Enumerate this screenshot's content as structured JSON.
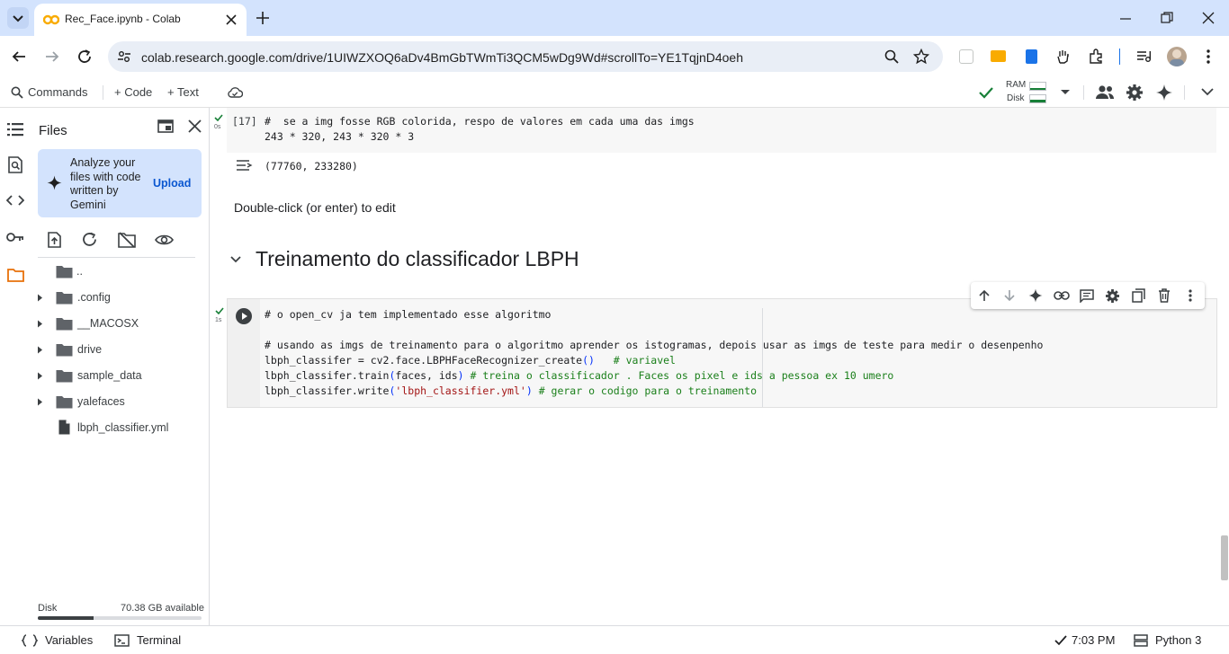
{
  "browser": {
    "tab_title": "Rec_Face.ipynb - Colab",
    "url": "colab.research.google.com/drive/1UIWZXOQ6aDv4BmGbTWmTi3QCM5wDg9Wd#scrollTo=YE1TqjnD4oeh"
  },
  "toolbar": {
    "commands_label": "Commands",
    "code_label": "+ Code",
    "text_label": "+ Text",
    "ram_label": "RAM",
    "disk_label": "Disk"
  },
  "sidebar": {
    "title": "Files",
    "gemini_prompt": "Analyze your files with code written by Gemini",
    "upload_label": "Upload",
    "tree": [
      {
        "name": "..",
        "type": "folder",
        "expandable": false
      },
      {
        "name": ".config",
        "type": "folder",
        "expandable": true
      },
      {
        "name": "__MACOSX",
        "type": "folder",
        "expandable": true
      },
      {
        "name": "drive",
        "type": "folder",
        "expandable": true
      },
      {
        "name": "sample_data",
        "type": "folder",
        "expandable": true
      },
      {
        "name": "yalefaces",
        "type": "folder",
        "expandable": true
      },
      {
        "name": "lbph_classifier.yml",
        "type": "file",
        "expandable": false
      }
    ],
    "disk_label": "Disk",
    "disk_available": "70.38 GB available",
    "disk_used_fraction": 0.34
  },
  "notebook": {
    "cell17": {
      "exec_count": "[17]",
      "exec_time": "0s",
      "line1_comment": "#  se a img fosse RGB colorida, respo de valores em cada uma das imgs",
      "line2": "243 * 320, 243 * 320 * 3",
      "output": "(77760, 233280)"
    },
    "text_cell": "Double-click (or enter) to edit",
    "section_heading": "Treinamento do classificador LBPH",
    "cell_train": {
      "exec_time": "1s",
      "l1_comment": "# o open_cv ja tem implementado esse algoritmo",
      "l3_comment": "# usando as imgs de treinamento para o algoritmo aprender os istogramas, depois usar as imgs de teste para medir o desenpenho",
      "l4_code": "lbph_classifer = cv2.face.LBPHFaceRecognizer_create",
      "l4_paren": "()",
      "l4_comment": "   # variavel",
      "l5_code": "lbph_classifer.train",
      "l5_paren_open": "(",
      "l5_args": "faces, ids",
      "l5_paren_close": ")",
      "l5_comment": " # treina o classificador . Faces os pixel e ids a pessoa ex 10 umero",
      "l6_code": "lbph_classifer.write",
      "l6_paren_open": "(",
      "l6_str": "'lbph_classifier.yml'",
      "l6_paren_close": ")",
      "l6_comment": " # gerar o codigo para o treinamento"
    }
  },
  "statusbar": {
    "variables_label": "Variables",
    "terminal_label": "Terminal",
    "time": "7:03 PM",
    "runtime": "Python 3"
  }
}
